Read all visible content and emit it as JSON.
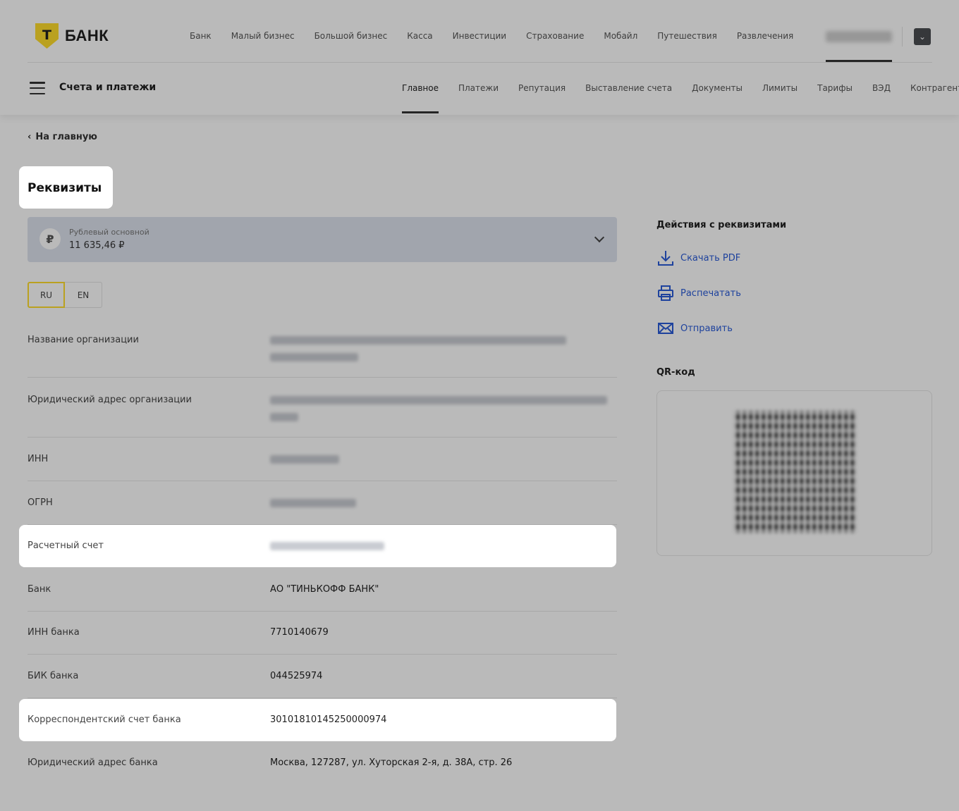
{
  "logo": {
    "letter": "Т",
    "text": "БАНК"
  },
  "top_nav": [
    "Банк",
    "Малый бизнес",
    "Большой бизнес",
    "Касса",
    "Инвестиции",
    "Страхование",
    "Мобайл",
    "Путешествия",
    "Развлечения"
  ],
  "section_title": "Счета и платежи",
  "sub_nav": [
    "Главное",
    "Платежи",
    "Репутация",
    "Выставление счета",
    "Документы",
    "Лимиты",
    "Тарифы",
    "ВЭД",
    "Контрагенты"
  ],
  "back_link": "На главную",
  "page_title": "Реквизиты",
  "account": {
    "currency_symbol": "₽",
    "name": "Рублевый основной",
    "balance": "11 635,46 ₽"
  },
  "languages": [
    "RU",
    "EN"
  ],
  "fields": [
    {
      "label": "Название организации",
      "value": ""
    },
    {
      "label": "Юридический адрес организации",
      "value": ""
    },
    {
      "label": "ИНН",
      "value": ""
    },
    {
      "label": "ОГРН",
      "value": ""
    },
    {
      "label": "Расчетный счет",
      "value": ""
    },
    {
      "label": "Банк",
      "value": "АО \"ТИНЬКОФФ БАНК\""
    },
    {
      "label": "ИНН банка",
      "value": "7710140679"
    },
    {
      "label": "БИК банка",
      "value": "044525974"
    },
    {
      "label": "Корреспондентский счет банка",
      "value": "30101810145250000974"
    },
    {
      "label": "Юридический адрес банка",
      "value": "Москва, 127287, ул. Хуторская 2-я, д. 38А, стр. 26"
    }
  ],
  "actions_title": "Действия с реквизитами",
  "actions": [
    {
      "label": "Скачать PDF",
      "icon": "download-icon"
    },
    {
      "label": "Распечатать",
      "icon": "printer-icon"
    },
    {
      "label": "Отправить",
      "icon": "mail-icon"
    }
  ],
  "qr_title": "QR-код",
  "colors": {
    "brand_yellow": "#ffdd2d",
    "link_blue": "#2a5bd7"
  }
}
